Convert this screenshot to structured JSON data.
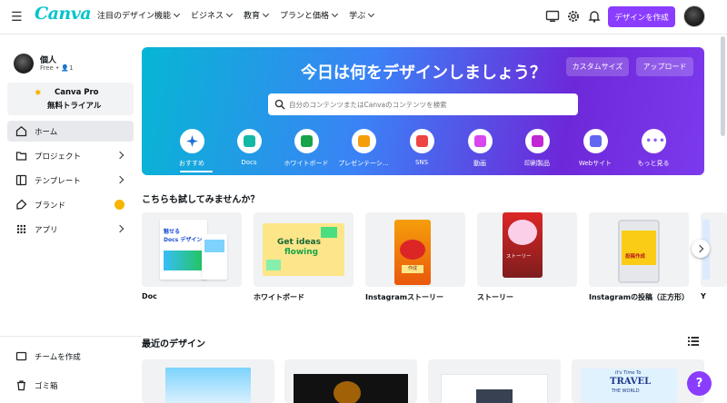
{
  "app": {
    "logo": "Canva"
  },
  "topnav": {
    "items": [
      {
        "label": "注目のデザイン機能"
      },
      {
        "label": "ビジネス"
      },
      {
        "label": "教育"
      },
      {
        "label": "プランと価格"
      },
      {
        "label": "学ぶ"
      }
    ],
    "create_label": "デザインを作成"
  },
  "sidebar": {
    "user_name": "個人",
    "user_plan": "Free • 👤1",
    "trial_line1": "Canva Pro",
    "trial_line2": "無料トライアル",
    "items": [
      {
        "label": "ホーム",
        "icon": "home-icon"
      },
      {
        "label": "プロジェクト",
        "icon": "folder-icon"
      },
      {
        "label": "テンプレート",
        "icon": "template-icon"
      },
      {
        "label": "ブランド",
        "icon": "brand-icon"
      },
      {
        "label": "アプリ",
        "icon": "apps-icon"
      }
    ],
    "team_label": "チームを作成",
    "trash_label": "ゴミ箱"
  },
  "hero": {
    "title": "今日は何をデザインしましょう？",
    "custom_size": "カスタムサイズ",
    "upload": "アップロード",
    "search_placeholder": "自分のコンテンツまたはCanvaのコンテンツを検索",
    "categories": [
      {
        "label": "おすすめ",
        "icon": "sparkle-icon",
        "color": "#1f6fd6"
      },
      {
        "label": "Docs",
        "icon": "docs-icon",
        "color": "#14b8a6"
      },
      {
        "label": "ホワイトボード",
        "icon": "whiteboard-icon",
        "color": "#16a34a"
      },
      {
        "label": "プレゼンテーシ…",
        "icon": "presentation-icon",
        "color": "#f59e0b"
      },
      {
        "label": "SNS",
        "icon": "heart-icon",
        "color": "#ef4444"
      },
      {
        "label": "動画",
        "icon": "video-icon",
        "color": "#d946ef"
      },
      {
        "label": "印刷製品",
        "icon": "print-icon",
        "color": "#c026d3"
      },
      {
        "label": "Webサイト",
        "icon": "website-icon",
        "color": "#6366f1"
      },
      {
        "label": "もっと見る",
        "icon": "more-icon",
        "color": "#8b5cf6"
      }
    ]
  },
  "try_section": {
    "title": "こちらも試してみませんか？",
    "cards": [
      {
        "label": "Doc"
      },
      {
        "label": "ホワイトボード"
      },
      {
        "label": "Instagramストーリー"
      },
      {
        "label": "ストーリー"
      },
      {
        "label": "Instagramの投稿（正方形）"
      },
      {
        "label": "Y"
      }
    ],
    "thumb_text": {
      "doc_title1": "魅せる",
      "doc_title2": "Docs デザイン",
      "wb_text1": "Get ideas",
      "wb_text2": "flowing",
      "ig_story_badge": "作成",
      "story_text": "ストーリー",
      "post_text": "投稿作成"
    }
  },
  "recent": {
    "title": "最近のデザイン",
    "card4_text1": "It's Time To",
    "card4_text2": "TRAVEL",
    "card4_text3": "THE WORLD"
  },
  "help_label": "?"
}
